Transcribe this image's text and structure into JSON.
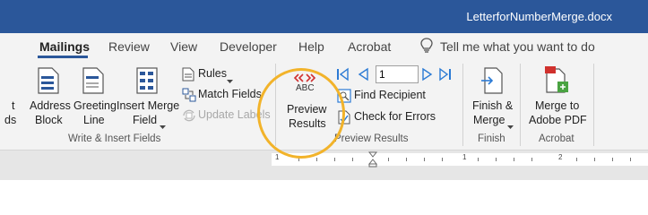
{
  "window": {
    "title": "LetterforNumberMerge.docx"
  },
  "tabs": [
    "Mailings",
    "Review",
    "View",
    "Developer",
    "Help",
    "Acrobat"
  ],
  "tell_me": "Tell me what you want to do",
  "groups": {
    "write_insert": {
      "label": "Write & Insert Fields",
      "left_cut_1": "t",
      "left_cut_2": "ds",
      "address_block": [
        "Address",
        "Block"
      ],
      "greeting_line": [
        "Greeting",
        "Line"
      ],
      "insert_merge_field": [
        "Insert Merge",
        "Field"
      ],
      "rules": "Rules",
      "match_fields": "Match Fields",
      "update_labels": "Update Labels"
    },
    "preview": {
      "label": "Preview Results",
      "icon_text": "ABC",
      "preview_results": [
        "Preview",
        "Results"
      ],
      "record_value": "1",
      "find_recipient": "Find Recipient",
      "check_errors": "Check for Errors"
    },
    "finish": {
      "label": "Finish",
      "finish_merge": [
        "Finish &",
        "Merge"
      ]
    },
    "acrobat": {
      "label": "Acrobat",
      "merge_pdf": [
        "Merge to",
        "Adobe PDF"
      ]
    }
  },
  "ruler": {
    "labels": [
      "1",
      "1",
      "1",
      "2"
    ]
  },
  "colors": {
    "title_bar": "#2b579a",
    "ribbon": "#f3f3f3",
    "highlight": "#f2b32a"
  }
}
